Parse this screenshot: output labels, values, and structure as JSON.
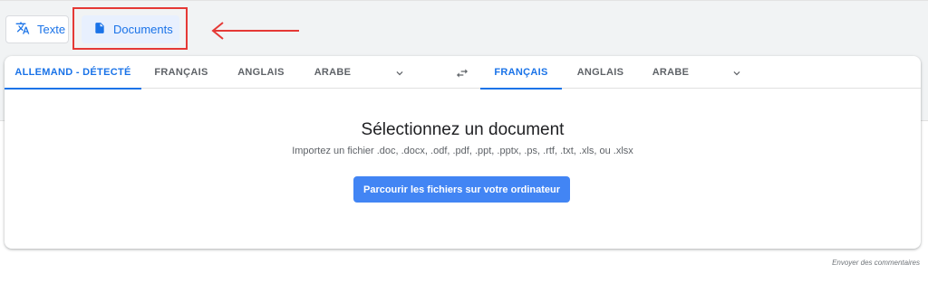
{
  "mode_buttons": {
    "text_label": "Texte",
    "documents_label": "Documents"
  },
  "source_tabs": [
    {
      "label": "ALLEMAND - DÉTECTÉ"
    },
    {
      "label": "FRANÇAIS"
    },
    {
      "label": "ANGLAIS"
    },
    {
      "label": "ARABE"
    }
  ],
  "target_tabs": [
    {
      "label": "FRANÇAIS"
    },
    {
      "label": "ANGLAIS"
    },
    {
      "label": "ARABE"
    }
  ],
  "upload": {
    "title": "Sélectionnez un document",
    "subtitle": "Importez un fichier .doc, .docx, .odf, .pdf, .ppt, .pptx, .ps, .rtf, .txt, .xls, ou .xlsx",
    "browse_label": "Parcourir les fichiers sur votre ordinateur"
  },
  "footer": {
    "feedback_label": "Envoyer des commentaires"
  },
  "colors": {
    "accent": "#1a73e8",
    "button_blue": "#4285f4",
    "annotation_red": "#e53935"
  }
}
